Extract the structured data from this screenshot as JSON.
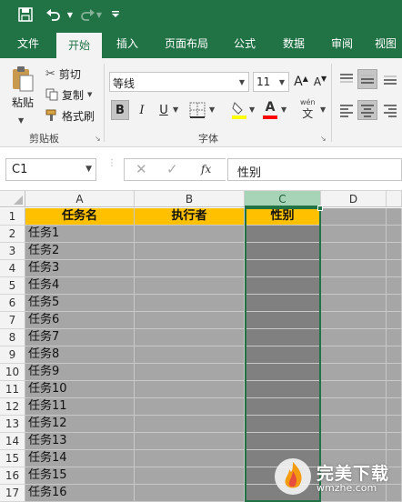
{
  "qat": {
    "icons": [
      "save-icon",
      "undo-icon",
      "redo-icon",
      "customize-icon"
    ]
  },
  "tabs": [
    {
      "label": "文件"
    },
    {
      "label": "开始"
    },
    {
      "label": "插入"
    },
    {
      "label": "页面布局"
    },
    {
      "label": "公式"
    },
    {
      "label": "数据"
    },
    {
      "label": "审阅"
    },
    {
      "label": "视图"
    }
  ],
  "ribbon": {
    "clipboard": {
      "paste": "粘贴",
      "cut": "剪切",
      "copy": "复制",
      "format_painter": "格式刷",
      "group_label": "剪贴板"
    },
    "font": {
      "font_name": "等线",
      "font_size": "11",
      "group_label": "字体",
      "bold": "B",
      "italic": "I",
      "underline": "U",
      "grow_font": "A",
      "shrink_font": "A",
      "font_color": "A",
      "phonetic": "wén",
      "phonetic_sub": "文"
    }
  },
  "formula_bar": {
    "name_box": "C1",
    "fx_label": "fx",
    "value": "性别"
  },
  "sheet": {
    "columns": [
      "A",
      "B",
      "C",
      "D"
    ],
    "rows": [
      "1",
      "2",
      "3",
      "4",
      "5",
      "6",
      "7",
      "8",
      "9",
      "10",
      "11",
      "12",
      "13",
      "14",
      "15",
      "16",
      "17"
    ],
    "headers": [
      "任务名",
      "执行者",
      "性别"
    ],
    "tasks": [
      "任务1",
      "任务2",
      "任务3",
      "任务4",
      "任务5",
      "任务6",
      "任务7",
      "任务8",
      "任务9",
      "任务10",
      "任务11",
      "任务12",
      "任务13",
      "任务14",
      "任务15",
      "任务16"
    ]
  },
  "colors": {
    "accent": "#217346",
    "header_fill": "#ffc000",
    "gray_fill": "#a6a6a6",
    "dark_fill": "#808080"
  },
  "watermark": {
    "brand": "完美下载",
    "url": "wmzhe.com"
  }
}
